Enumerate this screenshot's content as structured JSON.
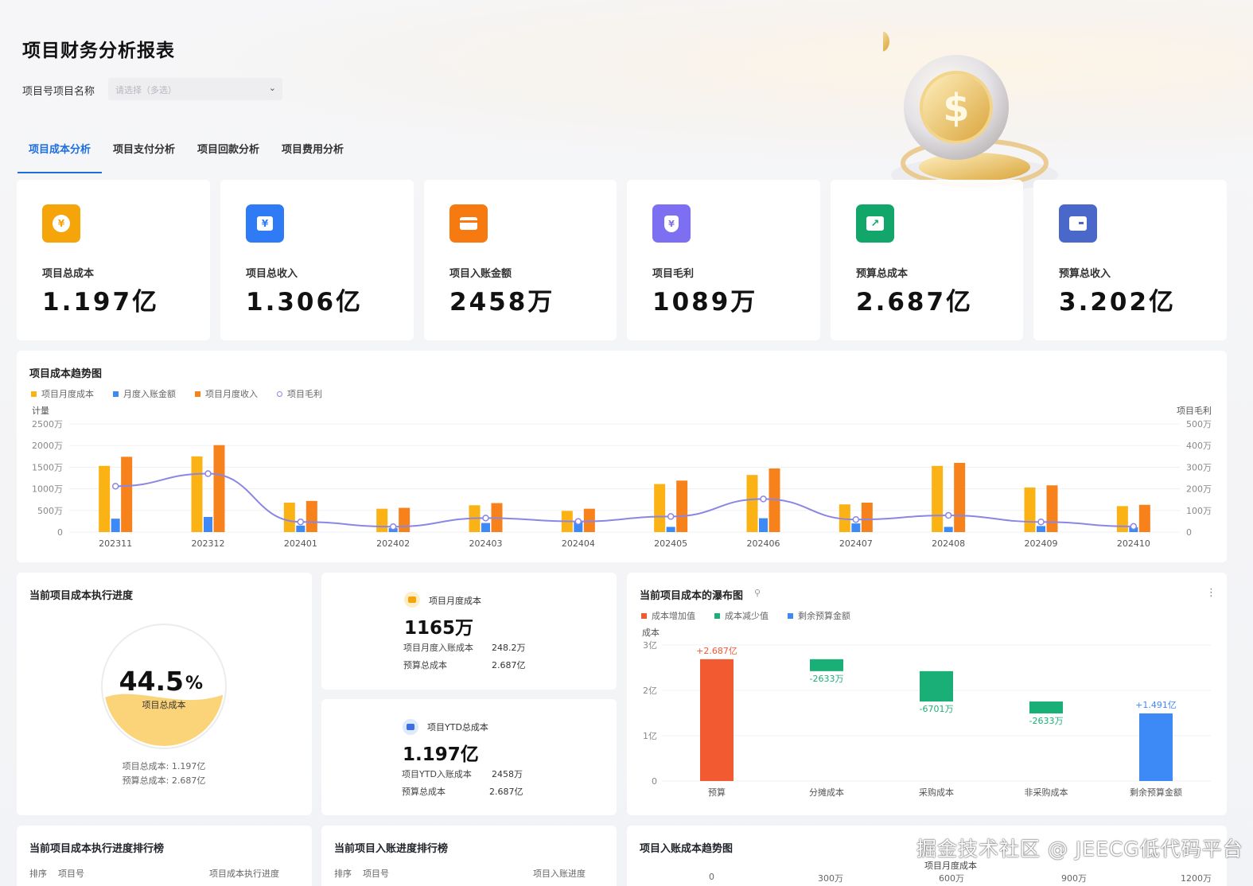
{
  "page": {
    "title": "项目财务分析报表"
  },
  "filter": {
    "label": "项目号项目名称",
    "placeholder": "请选择（多选）"
  },
  "tabs": [
    {
      "label": "项目成本分析",
      "active": true
    },
    {
      "label": "项目支付分析",
      "active": false
    },
    {
      "label": "项目回款分析",
      "active": false
    },
    {
      "label": "项目费用分析",
      "active": false
    }
  ],
  "kpis": [
    {
      "label": "项目总成本",
      "value": "1.197亿",
      "icon": "yen-coin-icon",
      "color": "#f5a40a",
      "glyph": "¥"
    },
    {
      "label": "项目总收入",
      "value": "1.306亿",
      "icon": "yen-wallet-icon",
      "color": "#2f7bf5",
      "glyph": "¥"
    },
    {
      "label": "项目入账金额",
      "value": "2458万",
      "icon": "card-icon",
      "color": "#f77a10",
      "glyph": "▬"
    },
    {
      "label": "项目毛利",
      "value": "1089万",
      "icon": "yen-shield-icon",
      "color": "#7c6ff2",
      "glyph": "¥"
    },
    {
      "label": "预算总成本",
      "value": "2.687亿",
      "icon": "trend-chart-icon",
      "color": "#12a66a",
      "glyph": "↗"
    },
    {
      "label": "预算总收入",
      "value": "3.202亿",
      "icon": "wallet-icon",
      "color": "#4a68c9",
      "glyph": "▭"
    }
  ],
  "trend": {
    "title": "项目成本趋势图",
    "legend": [
      {
        "name": "项目月度成本",
        "color": "#fbb214"
      },
      {
        "name": "月度入账金额",
        "color": "#3d8af7"
      },
      {
        "name": "项目月度收入",
        "color": "#f7821b"
      },
      {
        "name": "项目毛利",
        "color": "#8b86e4"
      }
    ],
    "left_axis_label": "计量",
    "right_axis_label": "项目毛利"
  },
  "progress": {
    "title": "当前项目成本执行进度",
    "percent": "44.5",
    "percent_sign": "%",
    "fill_fraction": 0.445,
    "caption": "项目总成本",
    "line1": "项目总成本: 1.197亿",
    "line2": "预算总成本: 2.687亿"
  },
  "monthly": {
    "icon": "coins-icon",
    "title": "项目月度成本",
    "value": "1165万",
    "rows": [
      {
        "label": "项目月度入账成本",
        "value": "248.2万"
      },
      {
        "label": "预算总成本",
        "value": "2.687亿"
      }
    ]
  },
  "ytd": {
    "icon": "wallet-icon",
    "title": "项目YTD总成本",
    "value": "1.197亿",
    "rows": [
      {
        "label": "项目YTD入账成本",
        "value": "2458万"
      },
      {
        "label": "预算总成本",
        "value": "2.687亿"
      }
    ]
  },
  "waterfall": {
    "title": "当前项目成本的瀑布图",
    "more_icon": "more-vertical-icon",
    "edit_icon": "link-icon",
    "legend": [
      {
        "name": "成本增加值",
        "color": "#f25a32"
      },
      {
        "name": "成本减少值",
        "color": "#1aaf77"
      },
      {
        "name": "剩余预算金额",
        "color": "#3d8af7"
      }
    ],
    "y_label": "成本"
  },
  "rank1": {
    "title": "当前项目成本执行进度排行榜",
    "cols": [
      "排序",
      "项目号",
      "项目成本执行进度"
    ]
  },
  "rank2": {
    "title": "当前项目入账进度排行榜",
    "cols": [
      "排序",
      "项目号",
      "项目入账进度"
    ]
  },
  "entry_trend": {
    "title": "项目入账成本趋势图",
    "series_label": "项目月度成本",
    "ticks": [
      "0",
      "300万",
      "600万",
      "900万",
      "1200万"
    ]
  },
  "watermark": "掘金技术社区 @ JEECG低代码平台",
  "chart_data": [
    {
      "type": "bar",
      "title": "项目成本趋势图",
      "categories": [
        "202311",
        "202312",
        "202401",
        "202402",
        "202403",
        "202404",
        "202405",
        "202406",
        "202407",
        "202408",
        "202409",
        "202410"
      ],
      "series": [
        {
          "name": "项目月度成本",
          "axis": "left",
          "values": [
            1530,
            1750,
            680,
            540,
            620,
            490,
            1110,
            1320,
            640,
            1530,
            1030,
            600
          ]
        },
        {
          "name": "月度入账金额",
          "axis": "left",
          "values": [
            310,
            350,
            150,
            90,
            210,
            230,
            120,
            320,
            200,
            120,
            140,
            110
          ]
        },
        {
          "name": "项目月度收入",
          "axis": "left",
          "values": [
            1740,
            2010,
            720,
            560,
            670,
            540,
            1190,
            1470,
            680,
            1600,
            1080,
            630
          ]
        },
        {
          "name": "项目毛利",
          "type": "line",
          "axis": "right",
          "values": [
            212,
            270,
            47,
            25,
            65,
            49,
            72,
            153,
            58,
            77,
            47,
            26
          ]
        }
      ],
      "ylabel": "计量",
      "ylim": [
        0,
        2500
      ],
      "yticks": [
        "0",
        "500万",
        "1000万",
        "1500万",
        "2000万",
        "2500万"
      ],
      "y2label": "项目毛利",
      "y2lim": [
        0,
        500
      ],
      "y2ticks": [
        "0",
        "100万",
        "200万",
        "300万",
        "400万",
        "500万"
      ],
      "grid": true,
      "legend": "top-left"
    },
    {
      "type": "bar",
      "title": "当前项目成本的瀑布图",
      "categories": [
        "预算",
        "分摊成本",
        "采购成本",
        "非采购成本",
        "剩余预算金额"
      ],
      "values": [
        2.687,
        -0.2633,
        -0.6701,
        -0.2633,
        1.491
      ],
      "data_labels": [
        "+2.687亿",
        "-2633万",
        "-6701万",
        "-2633万",
        "+1.491亿"
      ],
      "ylabel": "成本",
      "ylim": [
        0,
        3
      ],
      "yticks": [
        "0",
        "1亿",
        "2亿",
        "3亿"
      ],
      "grid": true,
      "legend": "top-left"
    }
  ]
}
